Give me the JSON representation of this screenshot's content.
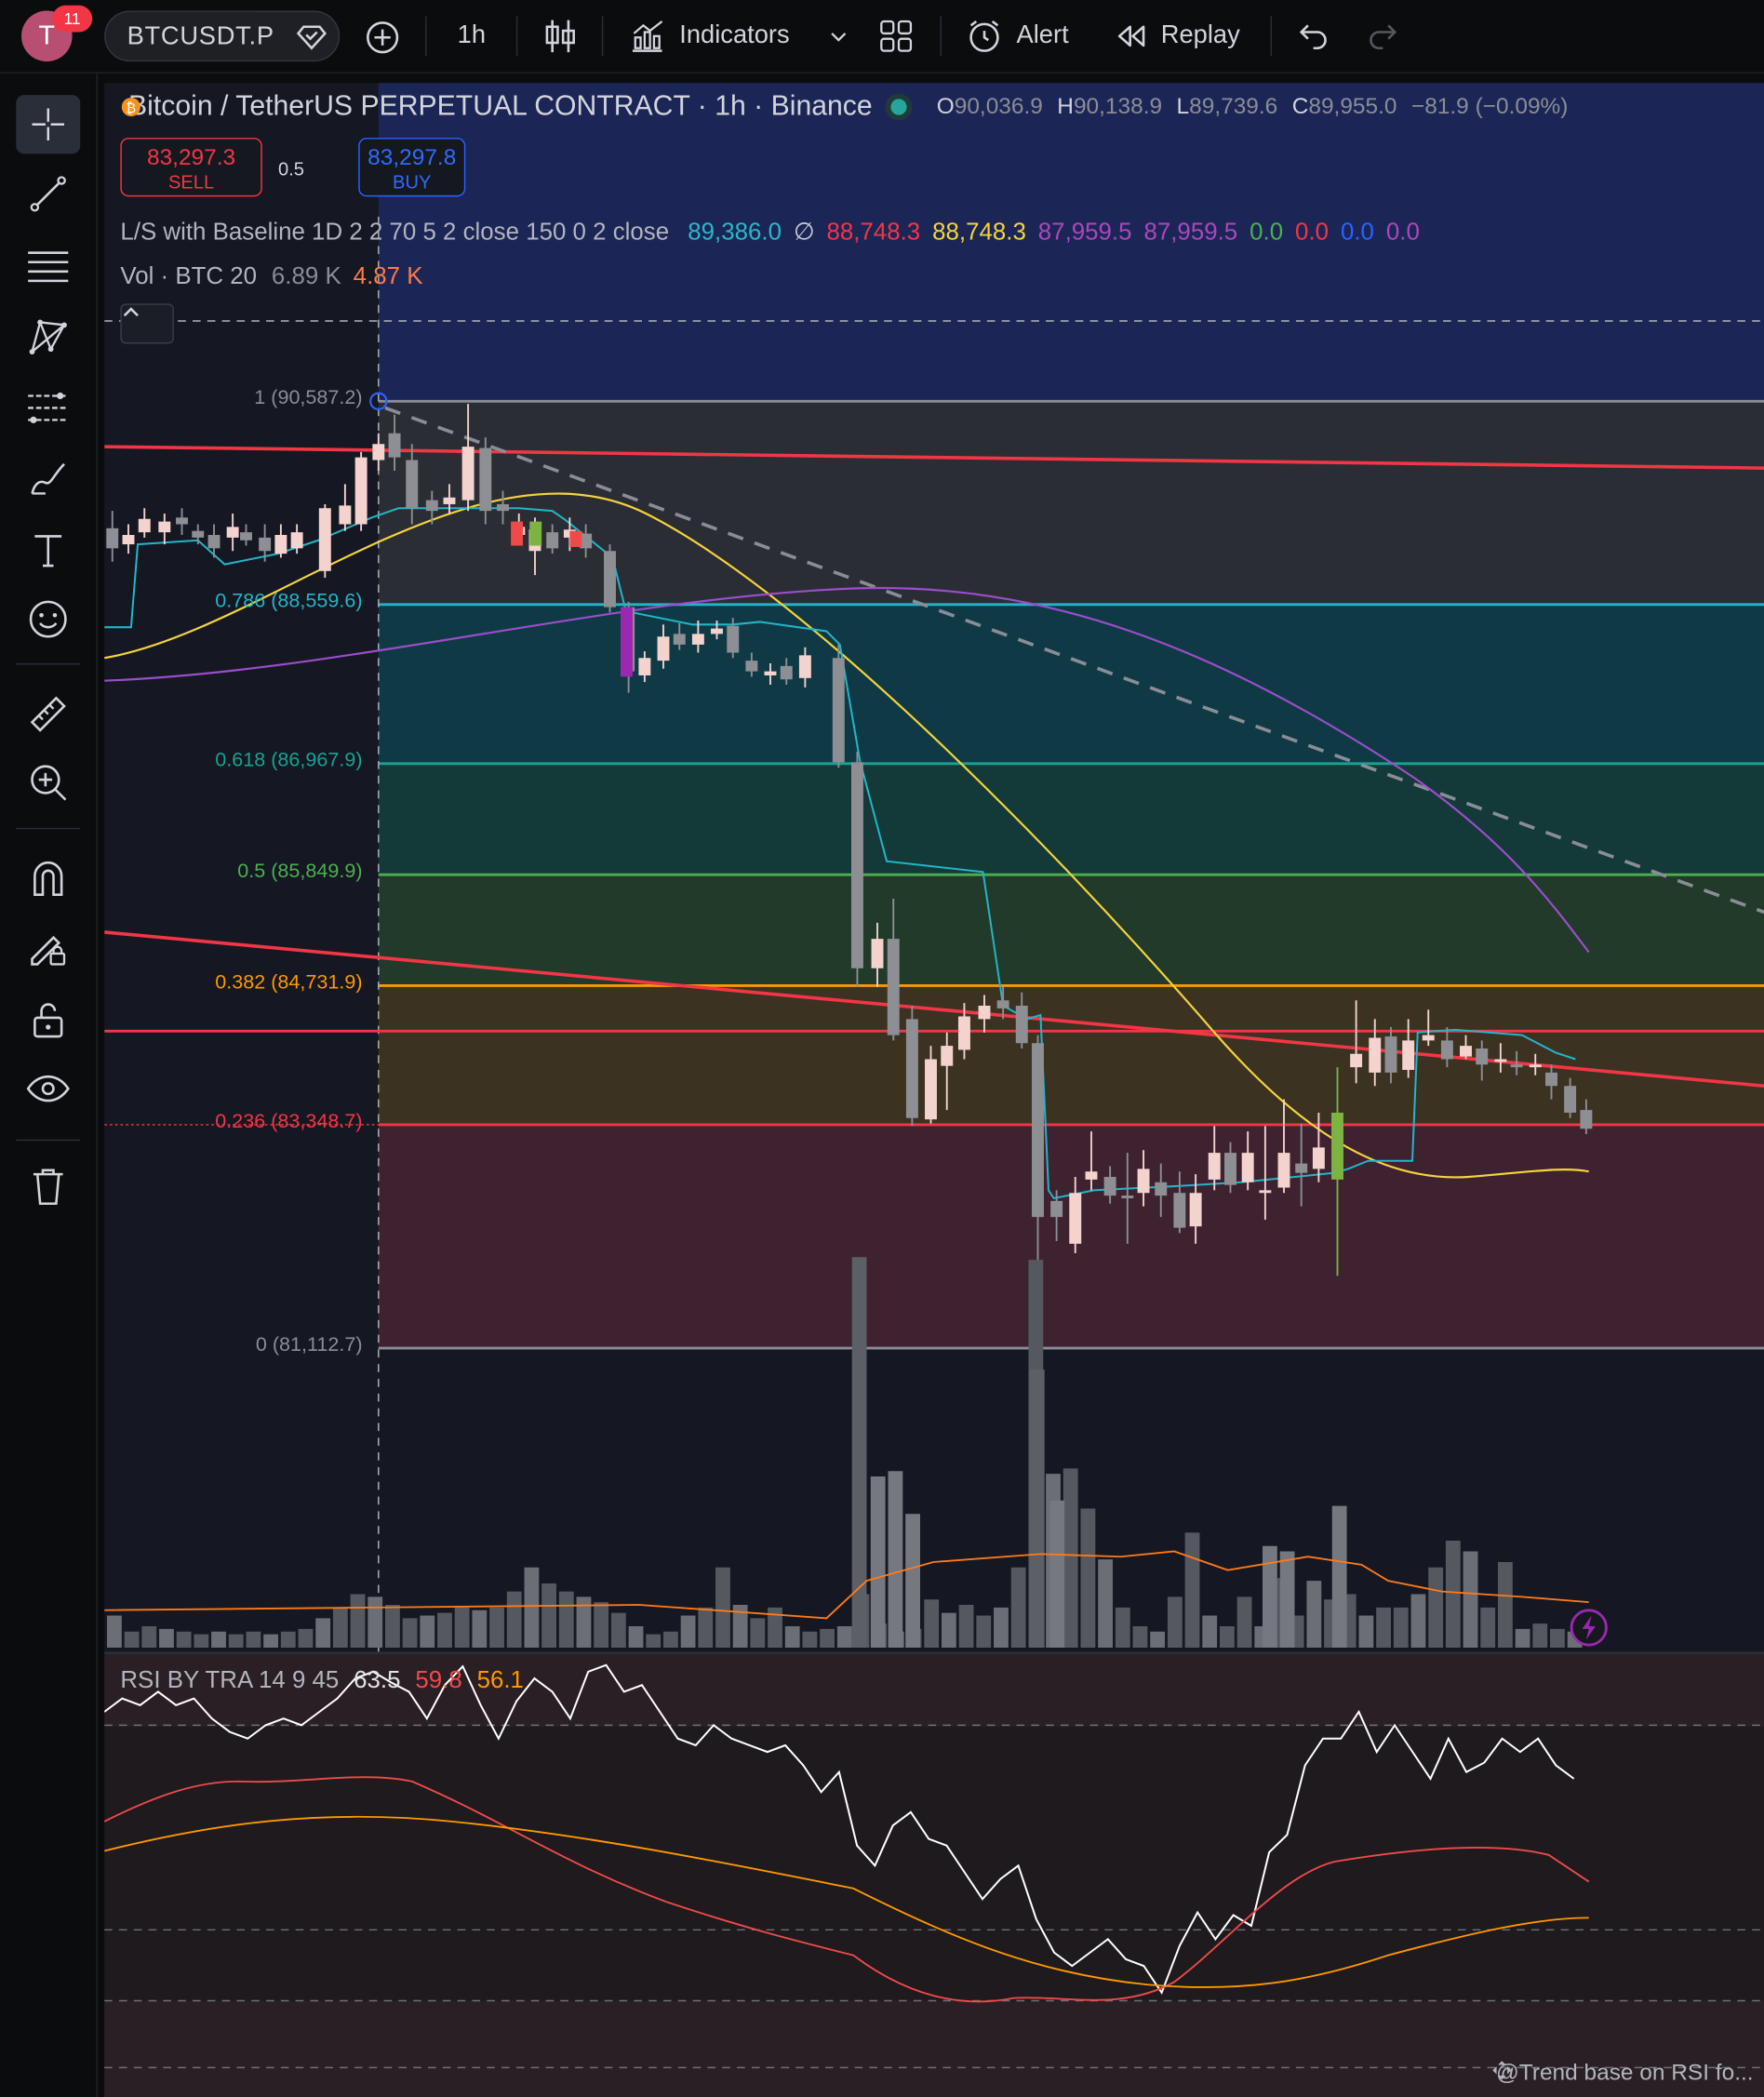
{
  "topbar": {
    "notification_count": "11",
    "avatar_letter": "T",
    "symbol": "BTCUSDT.P",
    "interval": "1h",
    "indicators_label": "Indicators",
    "alert_label": "Alert",
    "replay_label": "Replay"
  },
  "legend": {
    "title": "Bitcoin / TetherUS PERPETUAL CONTRACT · 1h · Binance",
    "o_label": "O",
    "o_value": "90,036.9",
    "h_label": "H",
    "h_value": "90,138.9",
    "l_label": "L",
    "l_value": "89,739.6",
    "c_label": "C",
    "c_value": "89,955.0",
    "change": "−81.9 (−0.09%)"
  },
  "trade": {
    "sell_price": "83,297.3",
    "sell_label": "SELL",
    "spread": "0.5",
    "buy_price": "83,297.8",
    "buy_label": "BUY"
  },
  "indicators": {
    "ls_name": "L/S with Baseline 1D 2 2 70 5 2 close 150 0 2 close",
    "ls_values": [
      "89,386.0",
      "∅",
      "88,748.3",
      "88,748.3",
      "87,959.5",
      "87,959.5",
      "0.0",
      "0.0",
      "0.0",
      "0.0"
    ],
    "ls_colors": [
      "#2ab7c8",
      "#c8ccd4",
      "#f23645",
      "#f5d33d",
      "#ab47bc",
      "#ab47bc",
      "#4caf50",
      "#f23645",
      "#2962ff",
      "#ab47bc"
    ],
    "vol_name": "Vol · BTC 20",
    "vol_values": [
      "6.89 K",
      "4.87 K"
    ],
    "rsi_name": "RSI BY TRA 14 9 45",
    "rsi_values": [
      "63.5",
      "59.8",
      "56.1"
    ]
  },
  "fib_levels": [
    {
      "label": "1 (90,587.2)",
      "color": "#8a8d96"
    },
    {
      "label": "0.786 (88,559.6)",
      "color": "#22b5c9"
    },
    {
      "label": "0.618 (86,967.9)",
      "color": "#16a394"
    },
    {
      "label": "0.5 (85,849.9)",
      "color": "#4caf50"
    },
    {
      "label": "0.382 (84,731.9)",
      "color": "#ff9800"
    },
    {
      "label": "0.236 (83,348.7)",
      "color": "#f23645"
    },
    {
      "label": "0 (81,112.7)",
      "color": "#8a8d96"
    }
  ],
  "footer_text": "@Trend base on RSI fo...",
  "sidebar_icons": [
    "crosshair-icon",
    "trendline-icon",
    "fib-retracement-icon",
    "pattern-icon",
    "projection-icon",
    "brush-icon",
    "text-icon",
    "emoji-icon",
    "ruler-icon",
    "zoom-in-icon",
    "magnet-icon",
    "lock-drawing-icon",
    "unlock-icon",
    "visibility-icon",
    "trash-icon"
  ],
  "colors": {
    "up_candle": "#f4d3cf",
    "down_candle": "#8d8f95",
    "rsi_line": "#ffffff",
    "rsi_signal": "#ef4a4a",
    "rsi_slow": "#ff9800",
    "accent_red": "#f23645"
  }
}
